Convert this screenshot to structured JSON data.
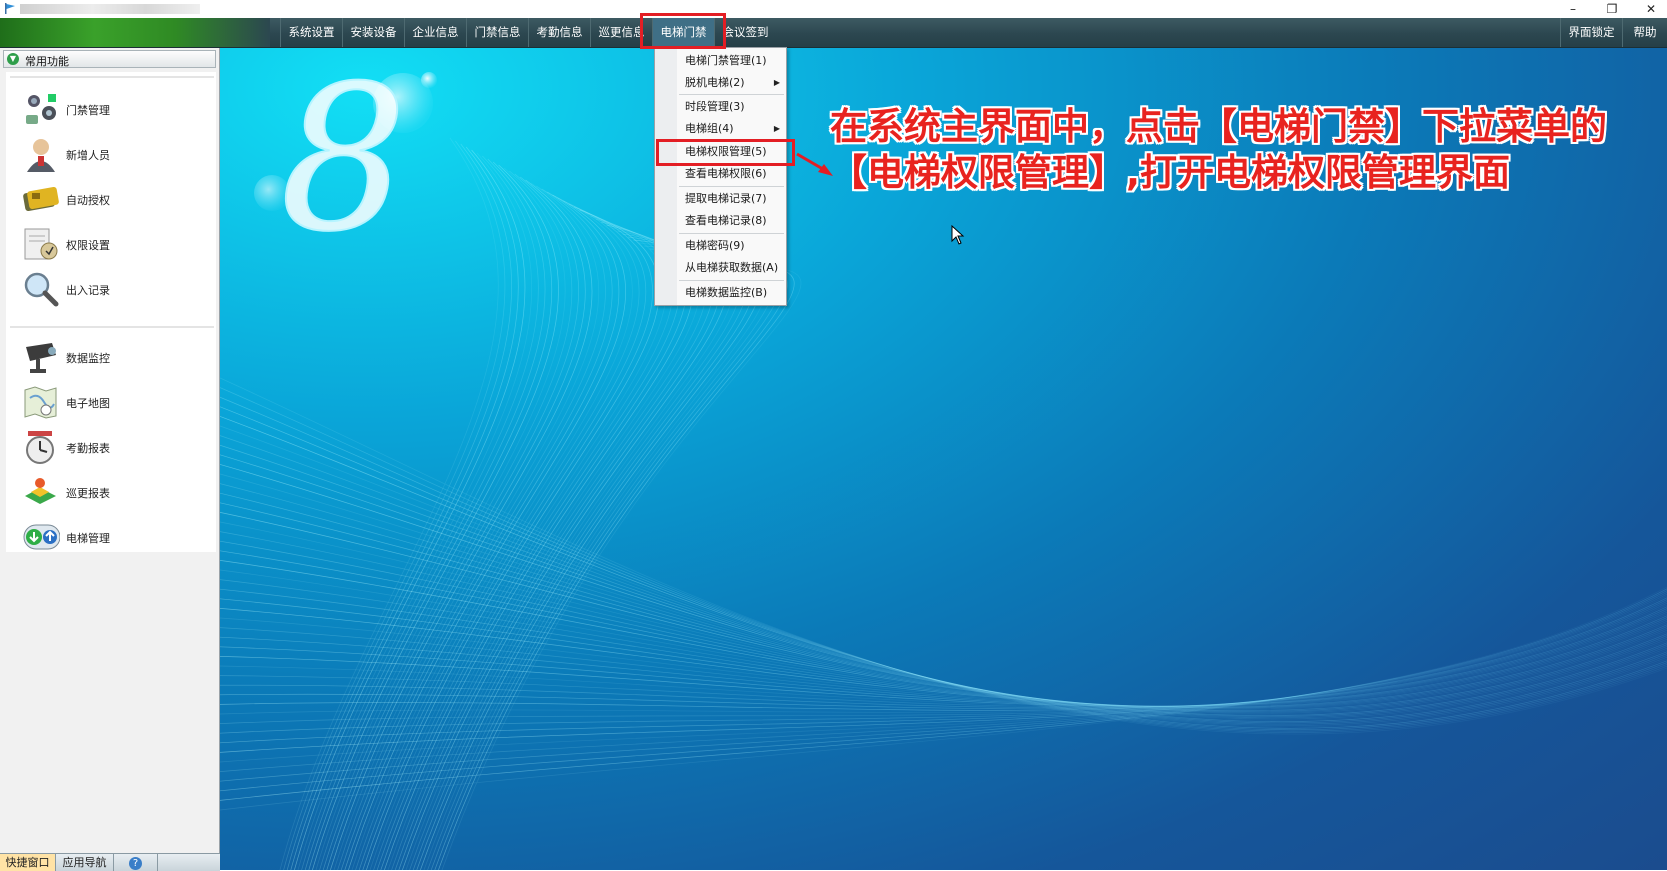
{
  "window": {
    "title": "",
    "controls": {
      "minimize": "–",
      "restore": "❐",
      "close": "✕"
    }
  },
  "menubar": {
    "items": [
      {
        "label": "系统设置"
      },
      {
        "label": "安装设备"
      },
      {
        "label": "企业信息"
      },
      {
        "label": "门禁信息"
      },
      {
        "label": "考勤信息"
      },
      {
        "label": "巡更信息"
      },
      {
        "label": "电梯门禁"
      },
      {
        "label": "会议签到"
      }
    ],
    "right_items": [
      {
        "label": "界面锁定"
      },
      {
        "label": "帮助"
      }
    ]
  },
  "leftpanel": {
    "header": "常用功能",
    "items": [
      {
        "label": "门禁管理",
        "icon": "access-control-icon"
      },
      {
        "label": "新增人员",
        "icon": "person-icon"
      },
      {
        "label": "自动授权",
        "icon": "card-icon"
      },
      {
        "label": "权限设置",
        "icon": "permission-doc-icon"
      },
      {
        "label": "出入记录",
        "icon": "magnifier-icon"
      },
      {
        "label": "数据监控",
        "icon": "camera-icon"
      },
      {
        "label": "电子地图",
        "icon": "map-icon"
      },
      {
        "label": "考勤报表",
        "icon": "clock-icon"
      },
      {
        "label": "巡更报表",
        "icon": "patrol-icon"
      },
      {
        "label": "电梯管理",
        "icon": "elevator-icon"
      }
    ],
    "bottom_tabs": [
      {
        "label": "快捷窗口"
      },
      {
        "label": "应用导航"
      },
      {
        "label": "?"
      }
    ]
  },
  "dropdown": {
    "items": [
      {
        "label": "电梯门禁管理(1)"
      },
      {
        "label": "脱机电梯(2)",
        "submenu": "▶"
      },
      {
        "label": "时段管理(3)"
      },
      {
        "label": "电梯组(4)",
        "submenu": "▶"
      },
      {
        "label": "电梯权限管理(5)"
      },
      {
        "label": "查看电梯权限(6)"
      },
      {
        "label": "提取电梯记录(7)"
      },
      {
        "label": "查看电梯记录(8)"
      },
      {
        "label": "电梯密码(9)"
      },
      {
        "label": "从电梯获取数据(A)"
      },
      {
        "label": "电梯数据监控(B)"
      }
    ]
  },
  "desktop": {
    "logo_glyph": "8"
  },
  "annotation": {
    "line1": "在系统主界面中，点击【电梯门禁】下拉菜单的",
    "line2": "【电梯权限管理】,打开电梯权限管理界面",
    "color": "#e8231f"
  },
  "colors": {
    "menubar": "#2c4750",
    "highlight": "#e31e24",
    "desktop_light": "#12dff5",
    "desktop_dark": "#1b4c8e"
  }
}
